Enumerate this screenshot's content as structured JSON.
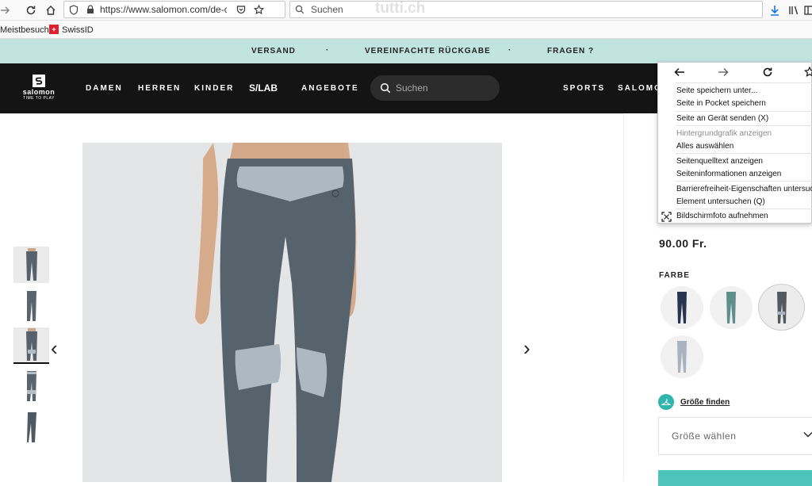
{
  "browser": {
    "url": "https://www.salomon.com/de-ch/",
    "search_placeholder": "Suchen",
    "watermark": "tutti.ch"
  },
  "bookmarks": {
    "items": [
      {
        "label": "Meistbesucht"
      },
      {
        "label": "SwissID"
      }
    ]
  },
  "promo": {
    "items": [
      "VERSAND",
      "VEREINFACHTE RÜCKGABE",
      "FRAGEN ?"
    ],
    "separator": "·"
  },
  "nav": {
    "logo_text": "salomon",
    "logo_tagline": "TIME TO PLAY",
    "items": [
      "DAMEN",
      "HERREN",
      "KINDER",
      "S/LAB",
      "ANGEBOTE"
    ],
    "right_items": [
      "SPORTS",
      "SALOMON"
    ],
    "search_placeholder": "Suchen"
  },
  "product": {
    "price": "90.00 Fr.",
    "color_label": "FARBE",
    "size_guide_link": "Größe finden",
    "size_select_placeholder": "Größe wählen",
    "swatches": [
      {
        "name": "navy",
        "color": "#2a3350"
      },
      {
        "name": "teal",
        "color": "#5f8f8c"
      },
      {
        "name": "grey",
        "color": "#53595f"
      },
      {
        "name": "light-grey",
        "color": "#aab3bd"
      }
    ],
    "selected_swatch": 2,
    "accent_color": "#2fb5ad"
  },
  "gallery": {
    "thumb_count": 5,
    "selected_thumb": 2,
    "prev_arrow": "‹",
    "next_arrow": "›"
  },
  "context_menu": {
    "items": [
      "Seite speichern unter...",
      "Seite in Pocket speichern",
      "Seite an Gerät senden (X)",
      "Hintergrundgrafik anzeigen",
      "Alles auswählen",
      "Seitenquelltext anzeigen",
      "Seiteninformationen anzeigen",
      "Barrierefreiheit-Eigenschaften untersuchen",
      "Element untersuchen (Q)",
      "Bildschirmfoto aufnehmen"
    ]
  }
}
